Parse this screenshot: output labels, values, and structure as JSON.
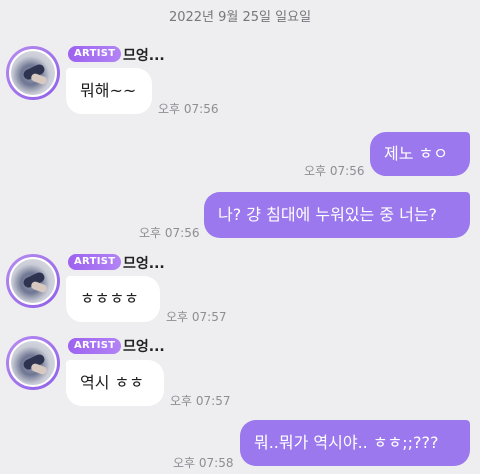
{
  "date_header": "2022년 9월 25일 일요일",
  "messages": [
    {
      "direction": "in",
      "badge": "ARTIST",
      "sender": "므엉...",
      "text": "뭐해~~",
      "time": "오후 07:56"
    },
    {
      "direction": "out",
      "text": "제노 ㅎㅇ",
      "time": "오후 07:56"
    },
    {
      "direction": "out",
      "text": "나? 걍 침대에 누워있는 중 너는?",
      "time": "오후 07:56"
    },
    {
      "direction": "in",
      "badge": "ARTIST",
      "sender": "므엉...",
      "text": "ㅎㅎㅎㅎ",
      "time": "오후 07:57"
    },
    {
      "direction": "in",
      "badge": "ARTIST",
      "sender": "므엉...",
      "text": "역시 ㅎㅎ",
      "time": "오후 07:57"
    },
    {
      "direction": "out",
      "text": "뭐..뭐가 역시야.. ㅎㅎ;;???",
      "time": "오후 07:58"
    }
  ],
  "colors": {
    "background": "#eeeef0",
    "outgoing_bubble": "#9b78ee",
    "incoming_bubble": "#ffffff",
    "badge": "#a06cf0"
  }
}
